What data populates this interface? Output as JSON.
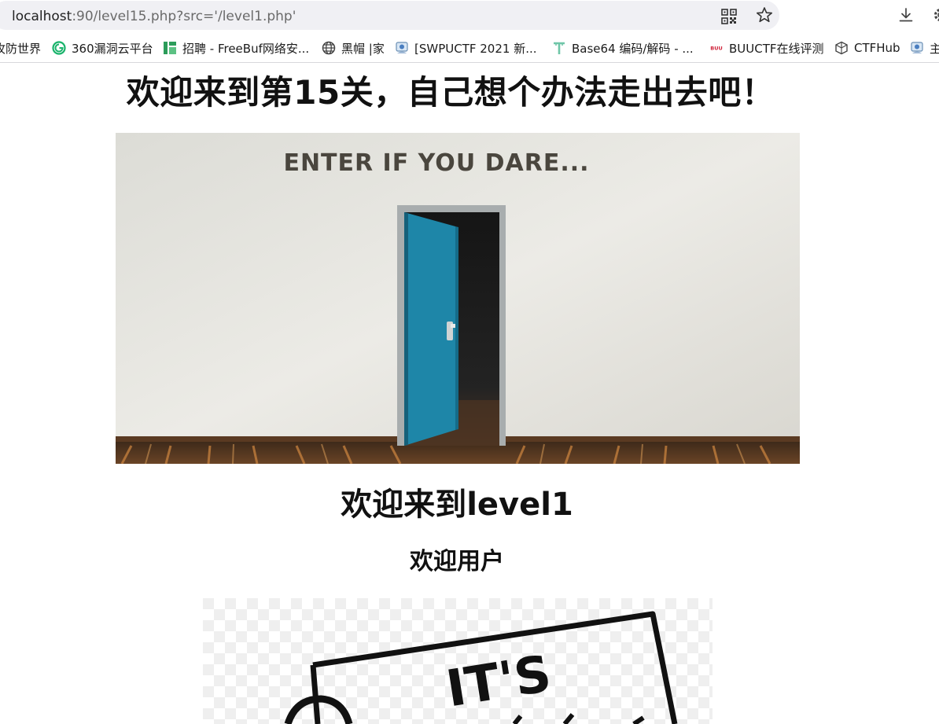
{
  "browser": {
    "url_host": "localhost",
    "url_rest": ":90/level15.php?src='/level1.php'",
    "bookmarks": [
      {
        "label": "攻防世界",
        "icon": "none"
      },
      {
        "label": "360漏洞云平台",
        "icon": "360-logo-icon"
      },
      {
        "label": "招聘 - FreeBuf网络安...",
        "icon": "freebuf-icon"
      },
      {
        "label": "黑帽 |家",
        "icon": "globe-icon"
      },
      {
        "label": "[SWPUCTF 2021 新...",
        "icon": "nssctf-icon"
      },
      {
        "label": "Base64 编码/解码 - ...",
        "icon": "t-logo-icon"
      },
      {
        "label": "BUUCTF在线评测",
        "icon": "buu-icon"
      },
      {
        "label": "CTFHub",
        "icon": "ctfhub-icon"
      },
      {
        "label": "主",
        "icon": "nssctf-icon"
      }
    ]
  },
  "page": {
    "title": "欢迎来到第15关，自己想个办法走出去吧！",
    "door_image_text": "ENTER IF YOU DARE...",
    "subtitle": "欢迎来到level1",
    "welcome": "欢迎用户",
    "sign_image_text": "IT'S"
  },
  "colors": {
    "door": "#1e86a8",
    "wall": "#e6e4df",
    "floor": "#7a4a26"
  }
}
